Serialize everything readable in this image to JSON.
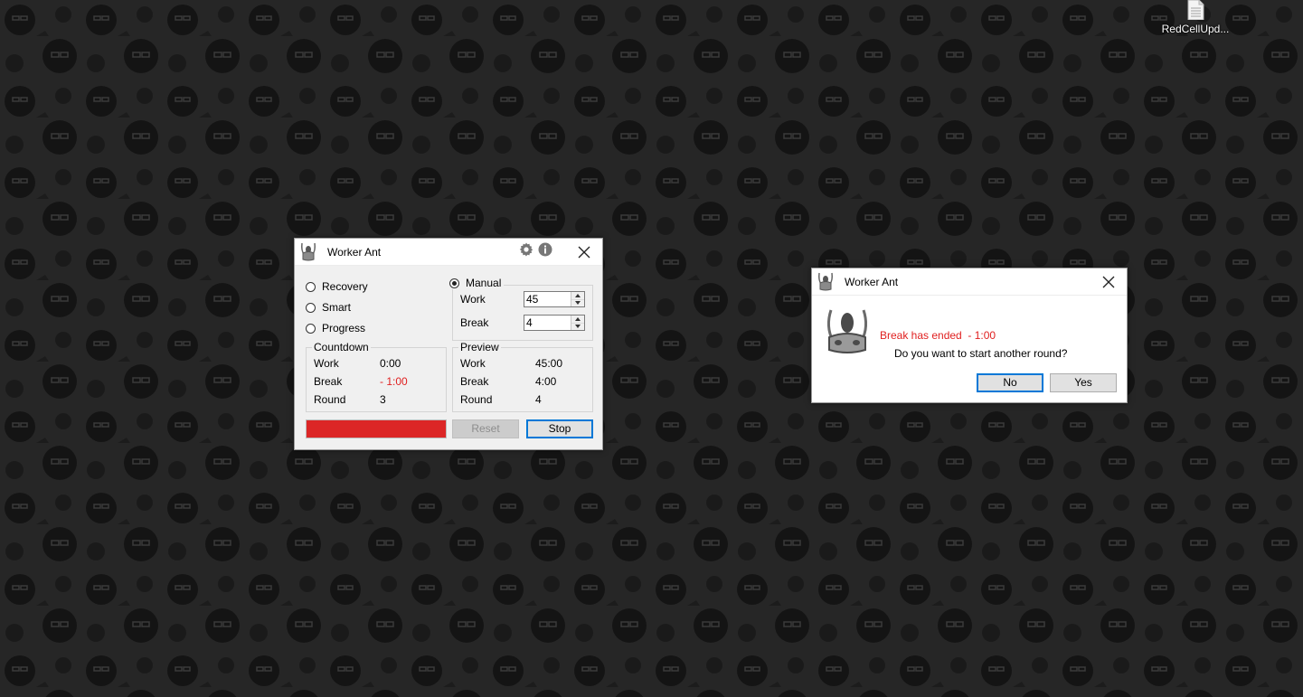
{
  "desktop": {
    "icon_label": "RedCellUpd...",
    "icon_name": "text-file-icon"
  },
  "main_window": {
    "title": "Worker Ant",
    "modes": [
      {
        "label": "Recovery",
        "selected": false
      },
      {
        "label": "Smart",
        "selected": false
      },
      {
        "label": "Progress",
        "selected": false
      }
    ],
    "manual": {
      "label": "Manual",
      "selected": true,
      "work_label": "Work",
      "work_value": "45",
      "break_label": "Break",
      "break_value": "4"
    },
    "countdown": {
      "title": "Countdown",
      "work_label": "Work",
      "work_value": "0:00",
      "break_label": "Break",
      "break_value": "- 1:00",
      "round_label": "Round",
      "round_value": "3"
    },
    "preview": {
      "title": "Preview",
      "work_label": "Work",
      "work_value": "45:00",
      "break_label": "Break",
      "break_value": "4:00",
      "round_label": "Round",
      "round_value": "4"
    },
    "progress_percent": 100,
    "reset_label": "Reset",
    "stop_label": "Stop"
  },
  "dialog": {
    "title": "Worker Ant",
    "message": "Break has ended  - 1:00",
    "question": "Do you want to start another round?",
    "no_label": "No",
    "yes_label": "Yes"
  },
  "colors": {
    "alert_red": "#e02020",
    "progress_red": "#dc2626",
    "focus_blue": "#0078d7",
    "wallpaper": "#262626"
  }
}
